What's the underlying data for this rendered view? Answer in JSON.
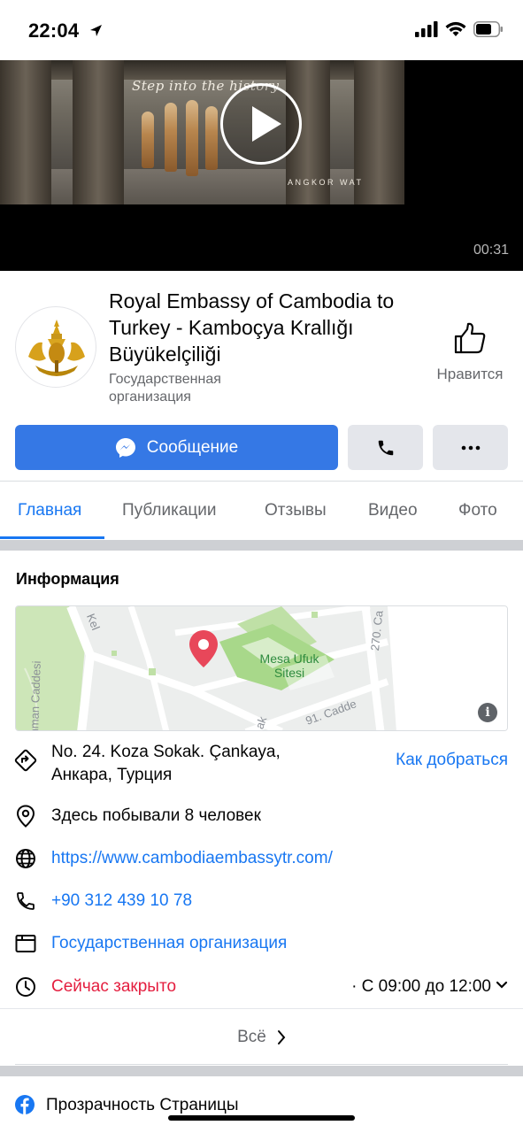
{
  "status_bar": {
    "time": "22:04"
  },
  "video": {
    "tagline": "Step into the history",
    "caption": "ANGKOR WAT",
    "duration": "00:31"
  },
  "page": {
    "name": "Royal Embassy of Cambodia to Turkey - Kamboçya Krallığı Büyükelçiliği",
    "category": "Государственная организация",
    "like_label": "Нравится"
  },
  "actions": {
    "message_label": "Сообщение"
  },
  "tabs": [
    {
      "label": "Главная",
      "active": true
    },
    {
      "label": "Публикации",
      "active": false
    },
    {
      "label": "Отзывы",
      "active": false
    },
    {
      "label": "Видео",
      "active": false
    },
    {
      "label": "Фото",
      "active": false
    }
  ],
  "info": {
    "title": "Информация",
    "map": {
      "park_label": "Mesa Ufuk Sitesi",
      "street_labels": [
        "Kel",
        "hman Caddesi",
        "270. Ca",
        "91. Cadde",
        "ak"
      ]
    },
    "address": "No. 24. Koza Sokak. Çankaya, Анкара, Турция",
    "directions_label": "Как добраться",
    "visitors": "Здесь побывали 8 человек",
    "website": "https://www.cambodiaembassytr.com/",
    "phone": "+90 312 439 10 78",
    "category": "Государственная организация",
    "status": "Сейчас закрыто",
    "hours": "· С 09:00 до 12:00",
    "see_all_label": "Всё"
  },
  "transparency": {
    "label": "Прозрачность Страницы"
  },
  "colors": {
    "accent": "#1877f2",
    "button_blue": "#3578e5",
    "closed_red": "#e41e3f",
    "secondary_text": "#65676b"
  }
}
